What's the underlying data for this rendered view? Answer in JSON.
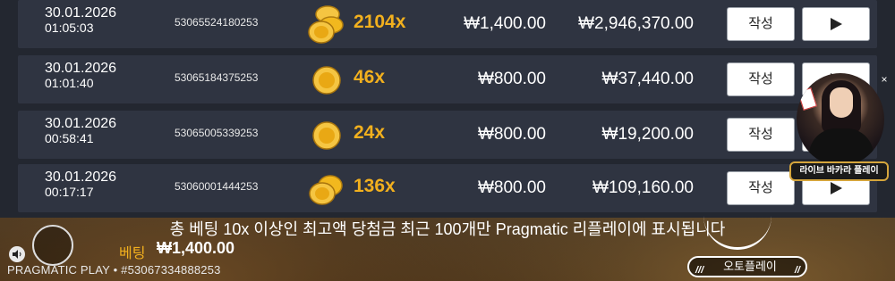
{
  "rows": [
    {
      "date": "30.01.2026",
      "time": "01:05:03",
      "round_id": "53065524180253",
      "coin": "stack-large",
      "multiplier": "2104x",
      "bet": "₩1,400.00",
      "win": "₩2,946,370.00",
      "write_label": "작성"
    },
    {
      "date": "30.01.2026",
      "time": "01:01:40",
      "round_id": "53065184375253",
      "coin": "single",
      "multiplier": "46x",
      "bet": "₩800.00",
      "win": "₩37,440.00",
      "write_label": "작성"
    },
    {
      "date": "30.01.2026",
      "time": "00:58:41",
      "round_id": "53065005339253",
      "coin": "single",
      "multiplier": "24x",
      "bet": "₩800.00",
      "win": "₩19,200.00",
      "write_label": "작성"
    },
    {
      "date": "30.01.2026",
      "time": "00:17:17",
      "round_id": "53060001444253",
      "coin": "stack-small",
      "multiplier": "136x",
      "bet": "₩800.00",
      "win": "₩109,160.00",
      "write_label": "작성"
    }
  ],
  "notice": "총 베팅 10x 이상인 최고액 당첨금 최근 100개만 Pragmatic 리플레이에 표시됩니다",
  "footer": {
    "brand": "PRAGMATIC PLAY • #53067334888253",
    "bet_label": "베팅",
    "bet_amount": "₩1,400.00",
    "autoplay_label": "오토플레이"
  },
  "promo": {
    "label": "라이브 바카라 플레이",
    "close": "×"
  },
  "colors": {
    "accent_gold": "#f2b01e",
    "row_bg": "#2f3441",
    "panel_bg": "#232730"
  }
}
